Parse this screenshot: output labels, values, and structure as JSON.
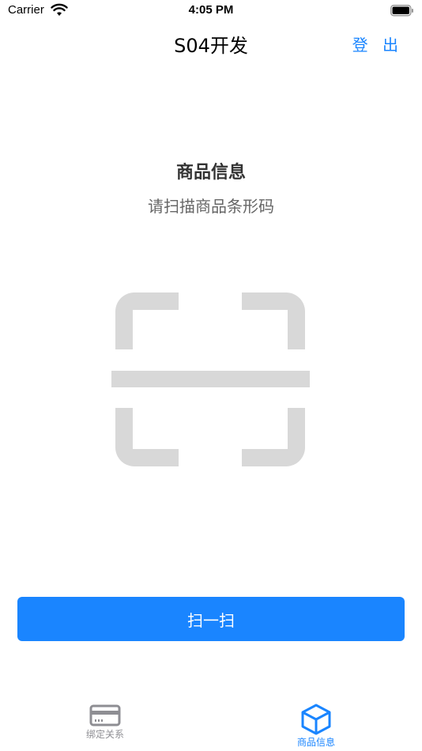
{
  "status_bar": {
    "carrier": "Carrier",
    "time": "4:05 PM"
  },
  "nav": {
    "title": "S04开发",
    "logout_label": "登 出"
  },
  "content": {
    "title": "商品信息",
    "subtitle": "请扫描商品条形码"
  },
  "scan_button": {
    "label": "扫一扫"
  },
  "tabs": [
    {
      "label": "绑定关系",
      "icon": "card-icon",
      "active": false
    },
    {
      "label": "商品信息",
      "icon": "box-icon",
      "active": true
    }
  ],
  "colors": {
    "accent": "#1a85ff",
    "inactive": "#8e8e93",
    "scan_graphic": "#d8d8d8"
  }
}
